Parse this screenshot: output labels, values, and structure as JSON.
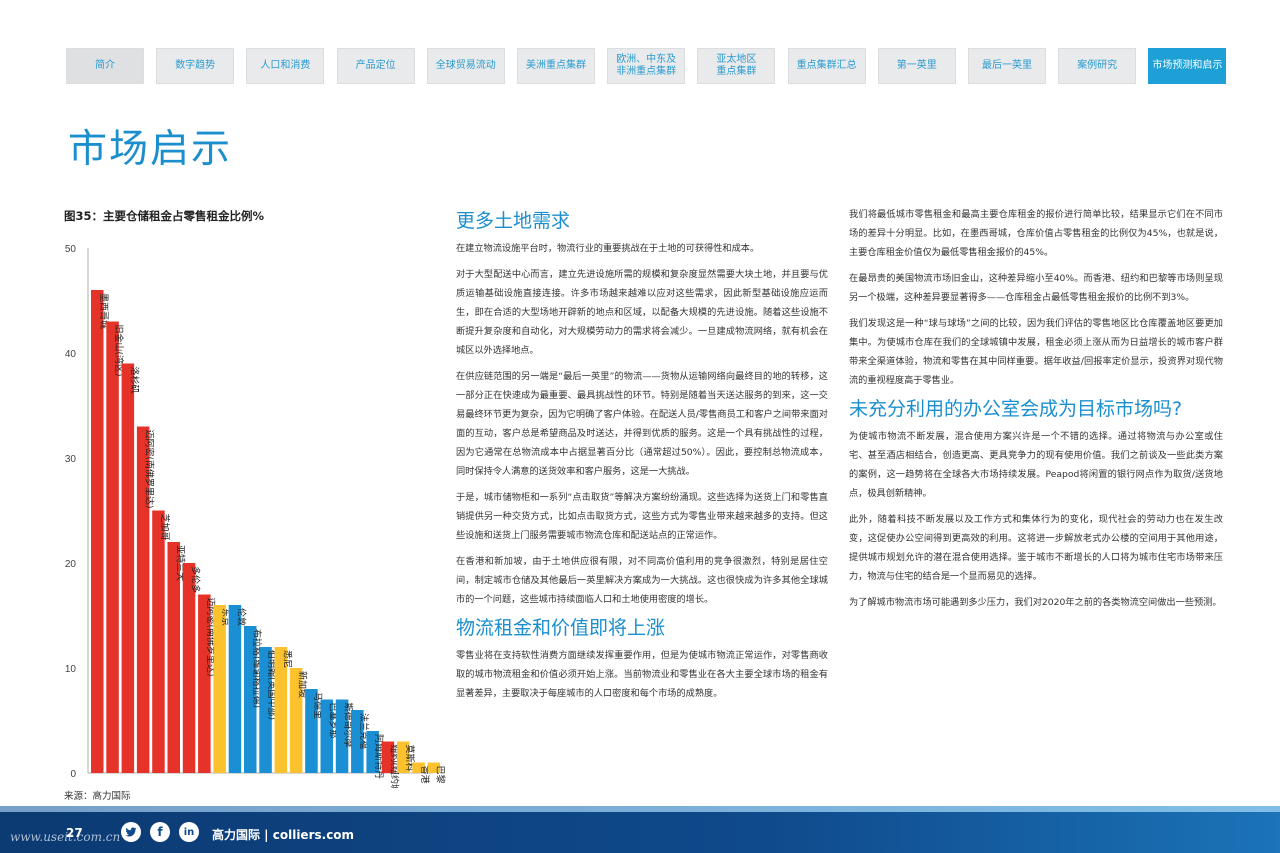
{
  "nav": {
    "tabs": [
      {
        "label": "简介"
      },
      {
        "label": "数字趋势"
      },
      {
        "label": "人口和消费"
      },
      {
        "label": "产品定位"
      },
      {
        "label": "全球贸易流动"
      },
      {
        "label": "美洲重点集群"
      },
      {
        "label": "欧洲、中东及\n非洲重点集群"
      },
      {
        "label": "亚太地区\n重点集群"
      },
      {
        "label": "重点集群汇总"
      },
      {
        "label": "第一英里"
      },
      {
        "label": "最后一英里"
      },
      {
        "label": "案例研究"
      },
      {
        "label": "市场预测和启示"
      }
    ],
    "active_index": 12
  },
  "page_title": "市场启示",
  "figure": {
    "title": "图35：主要仓储租金占零售租金比例%",
    "source": "来源：高力国际"
  },
  "chart_data": {
    "type": "bar",
    "title": "图35：主要仓储租金占零售租金比例%",
    "ylim": [
      0,
      50
    ],
    "yticks": [
      0,
      10,
      20,
      30,
      40,
      50
    ],
    "grid": false,
    "legend": "none",
    "colors": {
      "red": "#e63329",
      "blue": "#1a8fd3",
      "yellow": "#fcc22d"
    },
    "categories": [
      "墨西哥城",
      "旧金山(湾区)",
      "洛杉矶",
      "迈阿密(南佛罗里达)",
      "芝加哥",
      "亚特兰大",
      "多伦多",
      "迈阿密(南佛罗里达)",
      "东京",
      "伦敦",
      "布拉格(维谢格拉德)",
      "伯明翰(英国中部)",
      "悉尼",
      "新加坡",
      "马德里",
      "巴塞罗那",
      "斯德哥尔摩",
      "法兰克福",
      "阿姆斯特丹",
      "纽约(纽约城/新泽西)",
      "莫斯科",
      "香港",
      "巴黎"
    ],
    "values": [
      46,
      43,
      39,
      33,
      25,
      22,
      20,
      17,
      16,
      16,
      14,
      12,
      12,
      10,
      8,
      7,
      7,
      6,
      4,
      3,
      3,
      1,
      1
    ],
    "bar_colors": [
      "red",
      "red",
      "red",
      "red",
      "red",
      "red",
      "red",
      "red",
      "yellow",
      "blue",
      "blue",
      "blue",
      "yellow",
      "yellow",
      "blue",
      "blue",
      "blue",
      "blue",
      "blue",
      "red",
      "yellow",
      "yellow",
      "yellow"
    ]
  },
  "body": {
    "col1": {
      "h1": "更多土地需求",
      "p1": "在建立物流设施平台时，物流行业的重要挑战在于土地的可获得性和成本。",
      "p2": "对于大型配送中心而言，建立先进设施所需的规模和复杂度显然需要大块土地，并且要与优质运输基础设施直接连接。许多市场越来越难以应对这些需求，因此新型基础设施应运而生，即在合适的大型场地开辟新的地点和区域，以配备大规模的先进设施。随着这些设施不断提升复杂度和自动化，对大规模劳动力的需求将会减少。一旦建成物流网络，就有机会在城区以外选择地点。",
      "p3": "在供应链范围的另一端是“最后一英里”的物流——货物从运输网络向最终目的地的转移，这一部分正在快速成为最重要、最具挑战性的环节。特别是随着当天送达服务的到来，这一交易最终环节更为复杂，因为它明确了客户体验。在配送人员/零售商员工和客户之间带来面对面的互动，客户总是希望商品及时送达，并得到优质的服务。这是一个具有挑战性的过程，因为它通常在总物流成本中占据显著百分比（通常超过50%）。因此，要控制总物流成本，同时保持令人满意的送货效率和客户服务，这是一大挑战。",
      "p4": "于是，城市储物柜和一系列“点击取货”等解决方案纷纷涌现。这些选择为送货上门和零售直销提供另一种交货方式，比如点击取货方式，这些方式为零售业带来越来越多的支持。但这些设施和送货上门服务需要城市物流仓库和配送站点的正常运作。",
      "p5": "在香港和新加坡，由于土地供应很有限，对不同高价值利用的竞争很激烈，特别是居住空间，制定城市仓储及其他最后一英里解决方案成为一大挑战。这也很快成为许多其他全球城市的一个问题，这些城市持续面临人口和土地使用密度的增长。",
      "h2": "物流租金和价值即将上涨",
      "p6": "零售业将在支持软性消费方面继续发挥重要作用，但是为使城市物流正常运作，对零售商收取的城市物流租金和价值必须开始上涨。当前物流业和零售业在各大主要全球市场的租金有显著差异，主要取决于每座城市的人口密度和每个市场的成熟度。"
    },
    "col2": {
      "p1": "我们将最低城市零售租金和最高主要仓库租金的报价进行简单比较，结果显示它们在不同市场的差异十分明显。比如，在墨西哥城，仓库价值占零售租金的比例仅为45%，也就是说，主要仓库租金价值仅为最低零售租金报价的45%。",
      "p2": "在最昂贵的美国物流市场旧金山，这种差异缩小至40%。而香港、纽约和巴黎等市场则呈现另一个极端，这种差异要显著得多——仓库租金占最低零售租金报价的比例不到3%。",
      "p3": "我们发现这是一种“球与球场”之间的比较，因为我们评估的零售地区比仓库覆盖地区要更加集中。为使城市仓库在我们的全球城镇中发展，租金必须上涨从而为日益增长的城市客户群带来全渠道体验，物流和零售在其中同样重要。据年收益/回报率定价显示，投资界对现代物流的重视程度高于零售业。",
      "h1": "未充分利用的办公室会成为目标市场吗?",
      "p4": "为使城市物流不断发展，混合使用方案兴许是一个不错的选择。通过将物流与办公室或住宅、甚至酒店相结合，创造更高、更具竞争力的现有使用价值。我们之前谈及一些此类方案的案例，这一趋势将在全球各大市场持续发展。Peapod将闲置的银行网点作为取货/送货地点，极具创新精神。",
      "p5": "此外，随着科技不断发展以及工作方式和集体行为的变化，现代社会的劳动力也在发生改变，这促使办公空间得到更高效的利用。这将进一步解放老式办公楼的空间用于其他用途，提供城市规划允许的潜在混合使用选择。鉴于城市不断增长的人口将为城市住宅市场带来压力，物流与住宅的结合是一个显而易见的选择。",
      "p6": "为了解城市物流市场可能遇到多少压力，我们对2020年之前的各类物流空间做出一些预测。"
    }
  },
  "footer": {
    "page_number": "27",
    "brand": "高力国际 | colliers.com",
    "social": {
      "twitter": "twitter-icon",
      "facebook": "f",
      "linkedin": "in"
    },
    "watermark": "www.useit.com.cn"
  }
}
